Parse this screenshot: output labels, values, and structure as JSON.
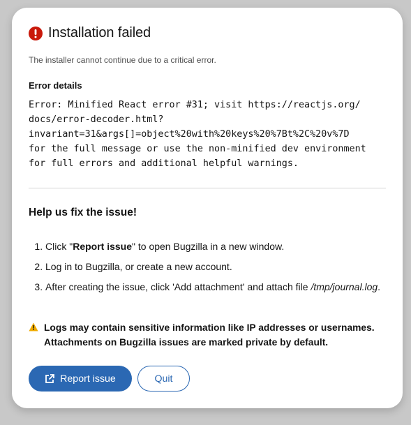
{
  "dialog": {
    "title": "Installation failed",
    "subtitle": "The installer cannot continue due to a critical error.",
    "error_label": "Error details",
    "error_lines": [
      "Error: Minified React error #31; visit https://reactjs.org/",
      "docs/error-decoder.html?",
      "invariant=31&args[]=object%20with%20keys%20%7Bt%2C%20v%7D",
      "for the full message or use the non-minified dev environment",
      "for full errors and additional helpful warnings."
    ],
    "help_title": "Help us fix the issue!",
    "steps": {
      "s1_pre": "Click \"",
      "s1_bold": "Report issue",
      "s1_post": "\" to open Bugzilla in a new window.",
      "s2": "Log in to Bugzilla, or create a new account.",
      "s3_pre": "After creating the issue, click 'Add attachment' and attach file ",
      "s3_italic": "/tmp/journal.log",
      "s3_post": "."
    },
    "warning_lines": [
      "Logs may contain sensitive information like IP addresses or usernames.",
      "Attachments on Bugzilla issues are marked private by default."
    ],
    "report_button": "Report issue",
    "quit_button": "Quit"
  },
  "icons": {
    "title_icon": "exclamation-circle-icon",
    "warning_icon": "warning-triangle-icon",
    "report_icon": "external-link-icon"
  },
  "colors": {
    "danger": "#c9190b",
    "warning": "#f0ab00",
    "primary": "#2b68b3",
    "backdrop": "#c8c8c8"
  }
}
